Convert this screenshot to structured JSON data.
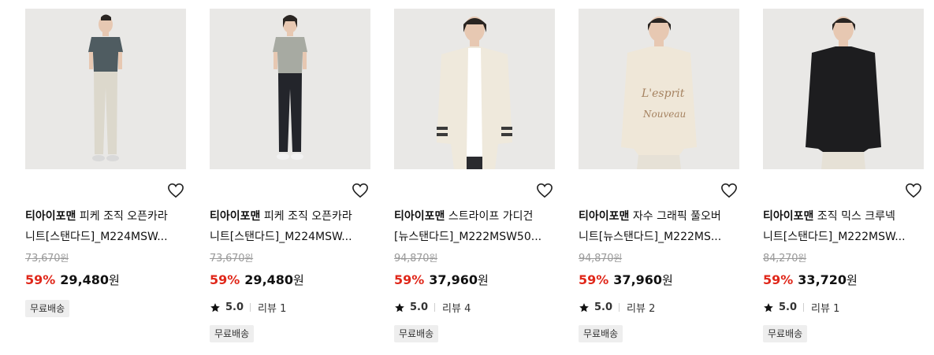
{
  "products": [
    {
      "brand": "티아이포맨",
      "name_line1": "피케 조직 오픈카라",
      "name_line2": "니트[스탠다드]_M224MSW...",
      "original_price": "73,670",
      "discount": "59%",
      "sale_price": "29,480",
      "currency": "원",
      "rating": null,
      "review_label": null,
      "badge": "무료배송",
      "colors": {
        "top": "#4f5c61",
        "bottom": "#dcd8cc",
        "skin": "#e7c8b2"
      }
    },
    {
      "brand": "티아이포맨",
      "name_line1": "피케 조직 오픈카라",
      "name_line2": "니트[스탠다드]_M224MSW...",
      "original_price": "73,670",
      "discount": "59%",
      "sale_price": "29,480",
      "currency": "원",
      "rating": "5.0",
      "review_label": "리뷰 1",
      "badge": "무료배송",
      "colors": {
        "top": "#a7aaa2",
        "bottom": "#23252b",
        "skin": "#e7c8b2"
      }
    },
    {
      "brand": "티아이포맨",
      "name_line1": "스트라이프 가디건",
      "name_line2": "[뉴스탠다드]_M222MSW50...",
      "original_price": "94,870",
      "discount": "59%",
      "sale_price": "37,960",
      "currency": "원",
      "rating": "5.0",
      "review_label": "리뷰 4",
      "badge": "무료배송",
      "colors": {
        "top": "#efe9dc",
        "bottom": "#2a2b2f",
        "skin": "#e7c8b2"
      }
    },
    {
      "brand": "티아이포맨",
      "name_line1": "자수 그래픽 풀오버",
      "name_line2": "니트[뉴스탠다드]_M222MS...",
      "original_price": "94,870",
      "discount": "59%",
      "sale_price": "37,960",
      "currency": "원",
      "rating": "5.0",
      "review_label": "리뷰 2",
      "badge": "무료배송",
      "colors": {
        "top": "#efe7d8",
        "bottom": "#e6e1d6",
        "skin": "#e7c8b2"
      }
    },
    {
      "brand": "티아이포맨",
      "name_line1": "조직 믹스 크루넥",
      "name_line2": "니트[스탠다드]_M222MSW...",
      "original_price": "84,270",
      "discount": "59%",
      "sale_price": "33,720",
      "currency": "원",
      "rating": "5.0",
      "review_label": "리뷰 1",
      "badge": "무료배송",
      "colors": {
        "top": "#1d1d1f",
        "bottom": "#e6e1d6",
        "skin": "#e7c8b2"
      }
    }
  ],
  "icons": {
    "wishlist": "heart-outline-icon",
    "rating": "star-icon"
  },
  "accent_color": "#e0281b"
}
